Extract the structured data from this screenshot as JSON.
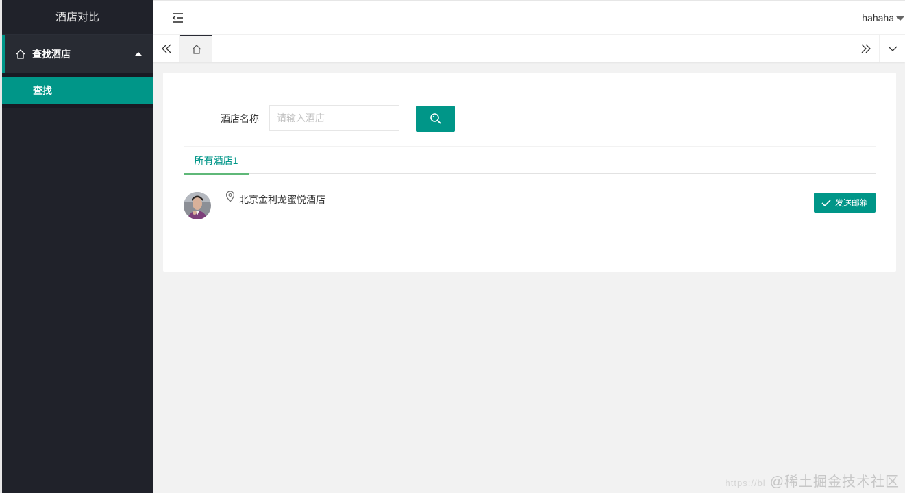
{
  "app": {
    "title": "酒店对比"
  },
  "sidebar": {
    "menu": {
      "label": "查找酒店",
      "icon": "home-icon",
      "expanded": true
    },
    "submenu": [
      {
        "label": "查找",
        "active": true
      }
    ]
  },
  "header": {
    "toggle_icon": "menu-fold-icon",
    "username": "hahaha"
  },
  "tabs_bar": {
    "home_icon": "home-icon",
    "left_icon": "double-chevron-left-icon",
    "right_icon": "double-chevron-right-icon",
    "menu_icon": "chevron-down-icon"
  },
  "search": {
    "label": "酒店名称",
    "placeholder": "请输入酒店",
    "value": "",
    "button_icon": "search-icon"
  },
  "results": {
    "tab_label": "所有酒店1",
    "items": [
      {
        "name": "北京金利龙蜜悦酒店",
        "action_label": "发送邮箱"
      }
    ]
  },
  "colors": {
    "accent": "#009688",
    "sidebar_bg": "#20222a",
    "tab_underline": "#5fb878"
  },
  "watermark": {
    "url": "https://bl",
    "text": "@稀土掘金技术社区"
  }
}
